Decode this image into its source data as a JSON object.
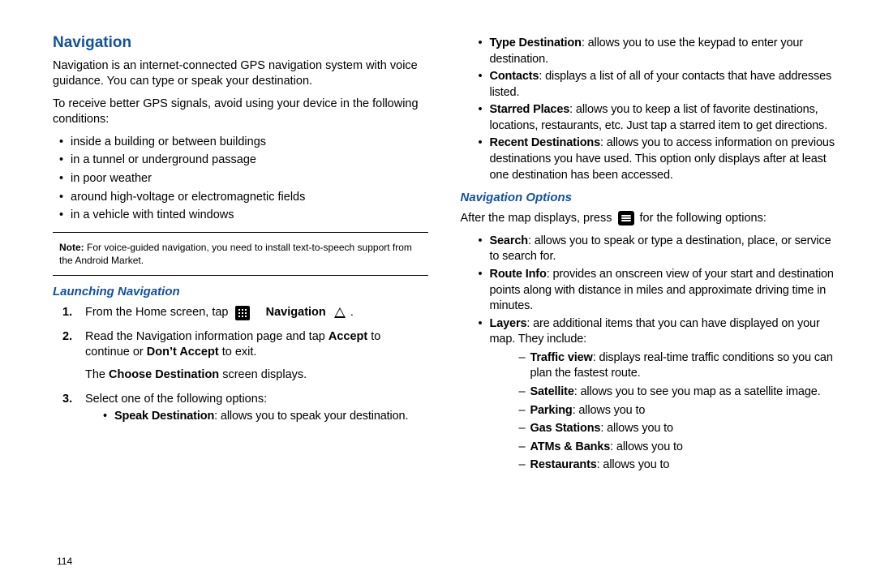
{
  "page_number": "114",
  "left": {
    "section_title": "Navigation",
    "intro_p1": "Navigation is an internet-connected GPS navigation system with voice guidance. You can type or speak your destination.",
    "intro_p2": "To receive better GPS signals, avoid using your device in the following conditions:",
    "conditions": [
      "inside a building or between buildings",
      "in a tunnel or underground passage",
      "in poor weather",
      "around high-voltage or electromagnetic fields",
      "in a vehicle with tinted windows"
    ],
    "note_label": "Note:",
    "note_text": "For voice-guided navigation, you need to install text-to-speech support from the Android Market.",
    "sub_title": "Launching Navigation",
    "step1_a": "From the Home screen, tap ",
    "step1_b": "Navigation",
    "step1_c": " .",
    "step2_a": "Read the Navigation information page and tap ",
    "step2_accept": "Accept",
    "step2_b": " to continue or ",
    "step2_dont": "Don’t Accept",
    "step2_c": " to exit.",
    "step2_sub_a": "The ",
    "step2_sub_bold": "Choose Destination",
    "step2_sub_b": " screen displays.",
    "step3": "Select one of the following options:",
    "step3_items": [
      {
        "b": "Speak Destination",
        "t": ": allows you to speak your destination."
      }
    ]
  },
  "right": {
    "top_bullets": [
      {
        "b": "Type Destination",
        "t": ": allows you to use the keypad to enter your destination."
      },
      {
        "b": "Contacts",
        "t": ": displays a list of all of your contacts that have addresses listed."
      },
      {
        "b": "Starred Places",
        "t": ": allows you to keep a list of favorite destinations, locations, restaurants, etc. Just tap a starred item to get directions."
      },
      {
        "b": "Recent Destinations",
        "t": ": allows you to access information on previous destinations you have used. This option only displays after at least one destination has been accessed."
      }
    ],
    "sub_title": "Navigation Options",
    "after_a": "After the map displays, press ",
    "after_b": " for the following options:",
    "options": [
      {
        "b": "Search",
        "t": ": allows you to speak or type a destination, place, or service to search for."
      },
      {
        "b": "Route Info",
        "t": ": provides an onscreen view of your start and destination points along with distance in miles and approximate driving time in minutes."
      },
      {
        "b": "Layers",
        "t": ": are additional items that you can have displayed on your map. They include:"
      }
    ],
    "layers": [
      {
        "b": "Traffic view",
        "t": ": displays real-time traffic conditions so you can plan the fastest route."
      },
      {
        "b": "Satellite",
        "t": ": allows you to see you map as a satellite image."
      },
      {
        "b": "Parking",
        "t": ": allows you to"
      },
      {
        "b": "Gas Stations",
        "t": ": allows you to"
      },
      {
        "b": "ATMs & Banks",
        "t": ": allows you to"
      },
      {
        "b": "Restaurants",
        "t": ": allows you to"
      }
    ]
  }
}
